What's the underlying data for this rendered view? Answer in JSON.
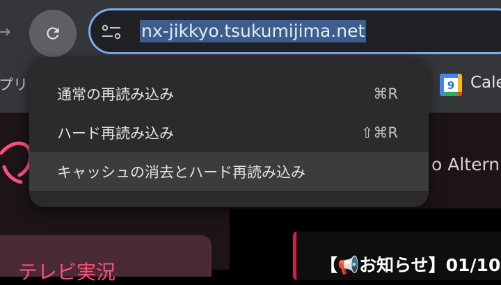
{
  "toolbar": {
    "forward_icon": "arrow-forward-icon",
    "reload_icon": "reload-icon",
    "site_info_icon": "tune-icon",
    "url": "nx-jikkyo.tsukumijima.net",
    "accent_color": "#7cacf8"
  },
  "bookmarks": {
    "apps_label": "プリ",
    "calendar_label": "Cale",
    "calendar_icon": "google-calendar-icon"
  },
  "page": {
    "alt_text": "o Altern",
    "tv_card_title": "テレビ実況",
    "news_title": "【📢お知らせ】01/10",
    "brand_color": "#ff4f7a"
  },
  "context_menu": {
    "items": [
      {
        "label": "通常の再読み込み",
        "shortcut": "⌘R"
      },
      {
        "label": "ハード再読み込み",
        "shortcut": "⇧⌘R"
      },
      {
        "label": "キャッシュの消去とハード再読み込み",
        "shortcut": ""
      }
    ]
  }
}
